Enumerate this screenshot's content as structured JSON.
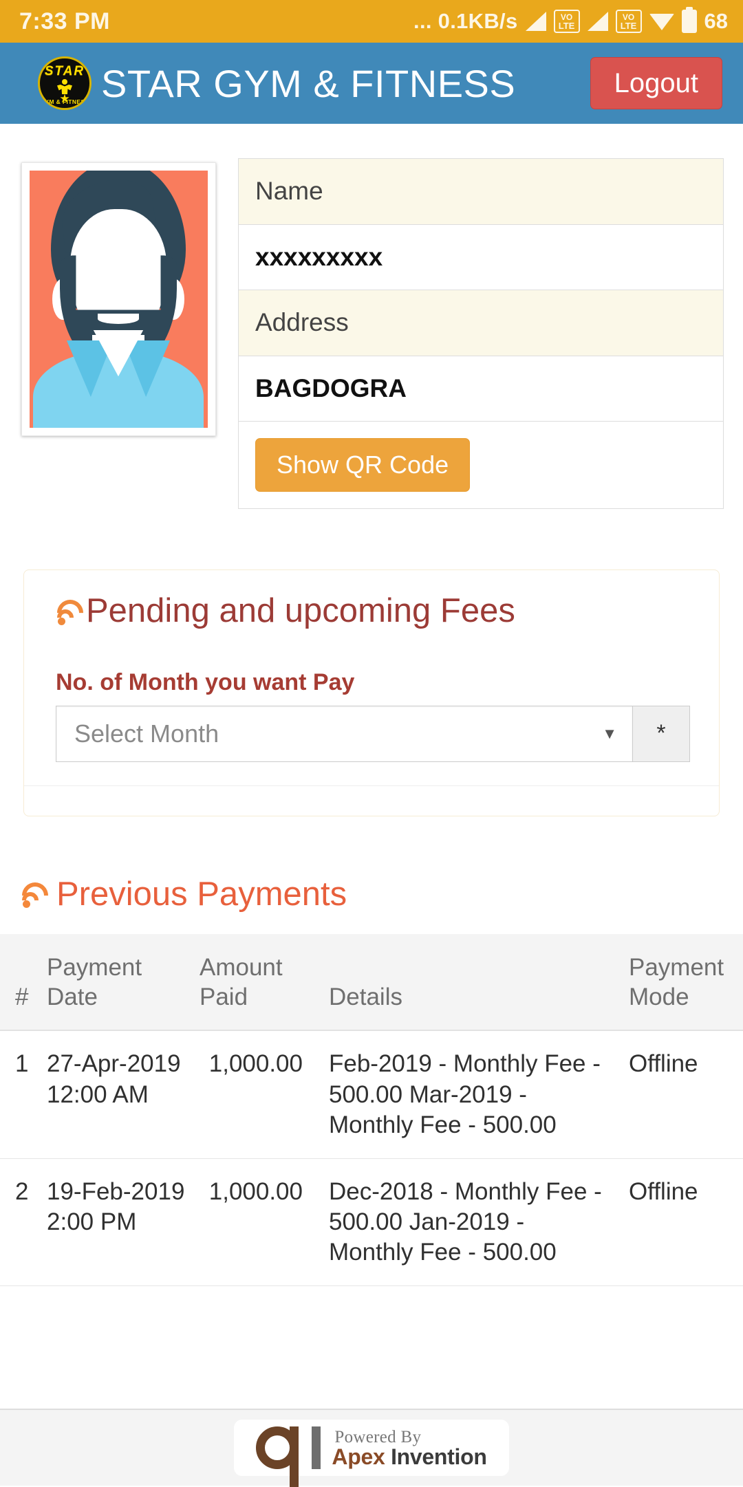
{
  "status_bar": {
    "time": "7:33 PM",
    "network_speed": "... 0.1KB/s",
    "volte_label_top": "VO",
    "volte_label_bottom": "LTE",
    "battery_percent": "68",
    "icons": [
      "signal-icon",
      "volte-icon",
      "signal-icon",
      "volte-icon",
      "wifi-icon",
      "battery-icon"
    ],
    "background_color": "#e9a81c"
  },
  "header": {
    "brand_name": "STAR GYM & FITNESS",
    "logo": {
      "top_text": "STAR",
      "bottom_text": "GYM  &  FITNESS",
      "icon": "star-gym-logo"
    },
    "logout_label": "Logout",
    "background_color": "#4089b9",
    "logout_color": "#d9534f"
  },
  "profile": {
    "avatar_icon": "default-user-avatar",
    "info": [
      {
        "label": "Name",
        "value": "xxxxxxxxx"
      },
      {
        "label": "Address",
        "value": "BAGDOGRA"
      }
    ],
    "qr_button_label": "Show QR Code",
    "qr_button_color": "#eda43c"
  },
  "pending_fees": {
    "title": "Pending and upcoming Fees",
    "title_icon": "rss-icon",
    "field_label": "No. of Month you want Pay",
    "select_placeholder": "Select Month",
    "select_chevron": "▼",
    "required_marker": "*",
    "title_color": "#9c3b36",
    "label_color": "#a63c33"
  },
  "previous_payments": {
    "title": "Previous Payments",
    "title_icon": "rss-icon",
    "title_color": "#e8603c",
    "columns": [
      "#",
      "Payment Date",
      "Amount Paid",
      "Details",
      "Payment Mode"
    ],
    "rows": [
      {
        "num": "1",
        "date": "27-Apr-2019 12:00 AM",
        "amount": "1,000.00",
        "details": "Feb-2019 - Monthly Fee - 500.00 Mar-2019 - Monthly Fee - 500.00",
        "mode": "Offline"
      },
      {
        "num": "2",
        "date": "19-Feb-2019 2:00 PM",
        "amount": "1,000.00",
        "details": "Dec-2018 - Monthly Fee - 500.00 Jan-2019 - Monthly Fee - 500.00",
        "mode": "Offline"
      }
    ]
  },
  "footer": {
    "powered_by": "Powered By",
    "company_first": "Apex",
    "company_second": "Invention",
    "logo_icon": "apex-invention-logo"
  }
}
